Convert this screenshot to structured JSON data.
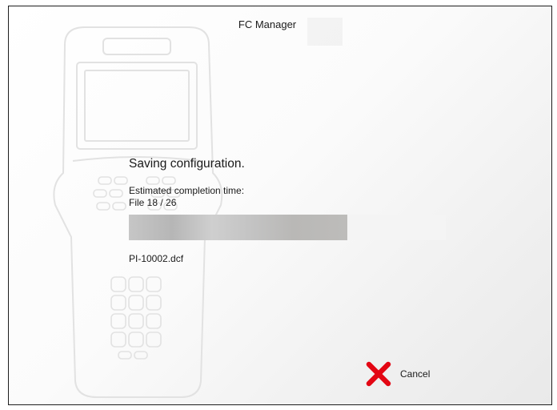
{
  "window": {
    "title": "FC Manager"
  },
  "status": {
    "heading": "Saving configuration.",
    "estimate_label": "Estimated completion time:",
    "file_progress": "File 18 / 26",
    "current_file": "PI-10002.dcf"
  },
  "progress": {
    "value_fraction": 0.69
  },
  "actions": {
    "cancel_label": "Cancel",
    "cancel_icon": "close-x-icon"
  },
  "colors": {
    "cancel_icon": "#e30613",
    "progress_fill": "#bdbdbd",
    "progress_track": "#f4f4f4"
  }
}
